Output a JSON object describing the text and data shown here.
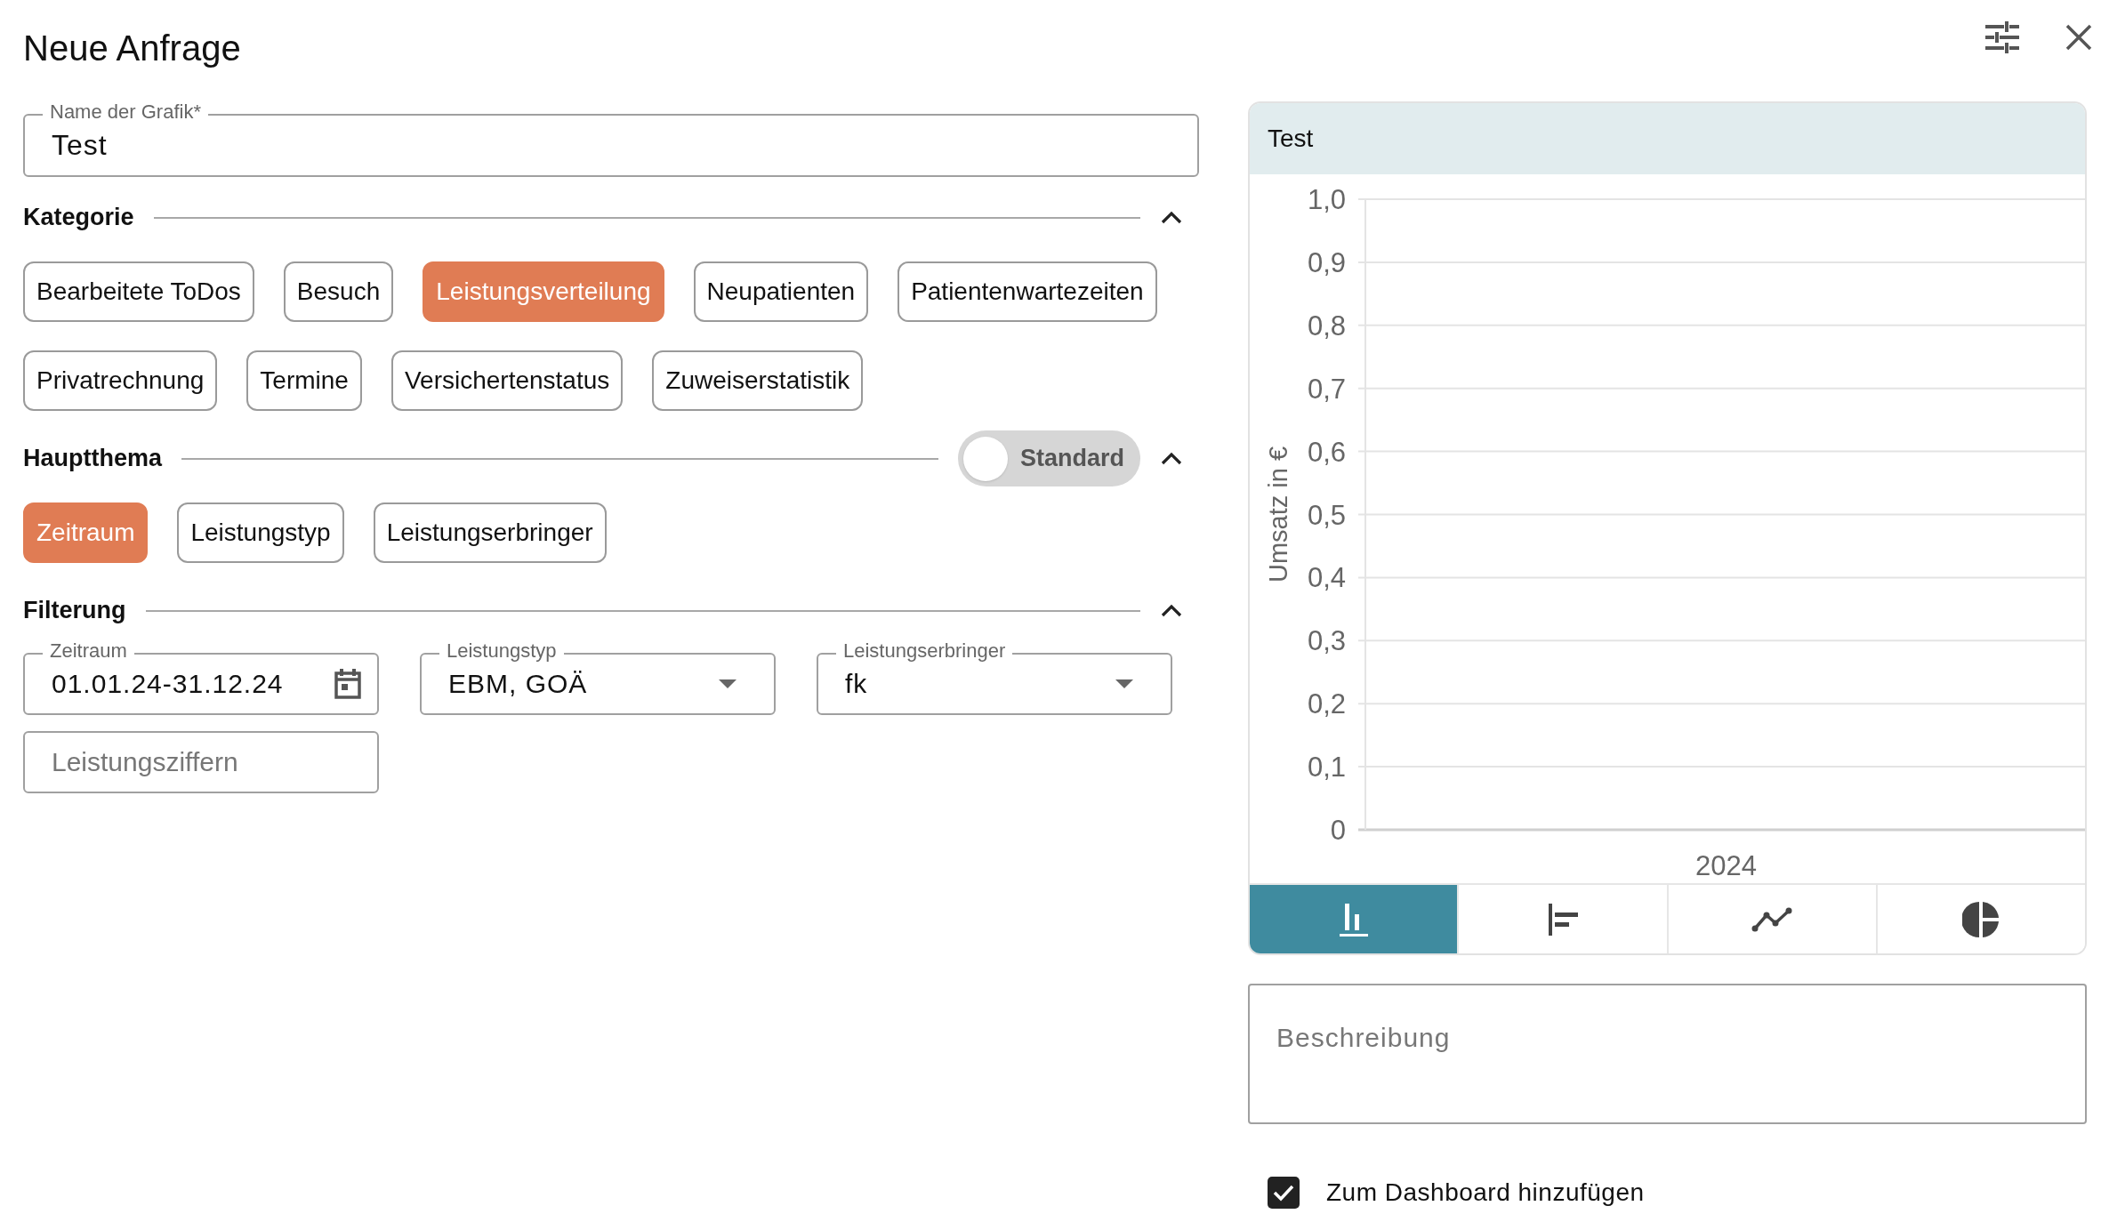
{
  "title": "Neue Anfrage",
  "name_field": {
    "label": "Name der Grafik*",
    "value": "Test"
  },
  "sections": [
    {
      "kind": "chips",
      "title": "Kategorie",
      "expanded": true,
      "chips": [
        {
          "label": "Bearbeitete ToDos",
          "selected": false
        },
        {
          "label": "Besuch",
          "selected": false
        },
        {
          "label": "Leistungsverteilung",
          "selected": true
        },
        {
          "label": "Neupatienten",
          "selected": false
        },
        {
          "label": "Patientenwartezeiten",
          "selected": false
        },
        {
          "label": "Privatrechnung",
          "selected": false
        },
        {
          "label": "Termine",
          "selected": false
        },
        {
          "label": "Versichertenstatus",
          "selected": false
        },
        {
          "label": "Zuweiserstatistik",
          "selected": false
        }
      ]
    },
    {
      "kind": "chips",
      "title": "Hauptthema",
      "expanded": true,
      "toggle": {
        "label": "Standard",
        "on": false
      },
      "chips": [
        {
          "label": "Zeitraum",
          "selected": true
        },
        {
          "label": "Leistungstyp",
          "selected": false
        },
        {
          "label": "Leistungserbringer",
          "selected": false
        }
      ]
    },
    {
      "kind": "fields",
      "title": "Filterung",
      "expanded": true,
      "fields": [
        {
          "kind": "date",
          "label": "Zeitraum",
          "value": "01.01.24-31.12.24"
        },
        {
          "kind": "select",
          "label": "Leistungstyp",
          "value": "EBM, GOÄ"
        },
        {
          "kind": "select",
          "label": "Leistungserbringer",
          "value": "fk"
        },
        {
          "kind": "text",
          "placeholder": "Leistungsziffern"
        }
      ]
    }
  ],
  "chart_card": {
    "chart_data": {
      "type": "bar",
      "grid": true,
      "title": "Test",
      "ylabel": "Umsatz in €",
      "categories": [
        "2024"
      ],
      "values": [
        null
      ],
      "ylim": [
        0,
        1
      ],
      "yticks": [
        {
          "value": 0,
          "label": "0"
        },
        {
          "value": 0.1,
          "label": "0,1"
        },
        {
          "value": 0.2,
          "label": "0,2"
        },
        {
          "value": 0.3,
          "label": "0,3"
        },
        {
          "value": 0.4,
          "label": "0,4"
        },
        {
          "value": 0.5,
          "label": "0,5"
        },
        {
          "value": 0.6,
          "label": "0,6"
        },
        {
          "value": 0.7,
          "label": "0,7"
        },
        {
          "value": 0.8,
          "label": "0,8"
        },
        {
          "value": 0.9,
          "label": "0,9"
        },
        {
          "value": 1,
          "label": "1,0"
        }
      ]
    },
    "chart_types": [
      {
        "kind": "bar",
        "selected": true
      },
      {
        "kind": "hbar",
        "selected": false
      },
      {
        "kind": "line",
        "selected": false
      },
      {
        "kind": "pie",
        "selected": false
      }
    ]
  },
  "description": {
    "placeholder": "Beschreibung"
  },
  "dashboard_checkbox": {
    "label": "Zum Dashboard hinzufügen",
    "checked": true
  }
}
